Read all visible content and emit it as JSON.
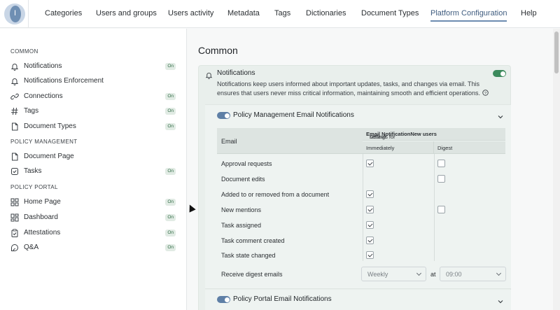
{
  "nav": {
    "logo_letter": "I",
    "items": [
      "Categories",
      "Users and groups",
      "Users activity",
      "Metadata",
      "Tags",
      "Dictionaries",
      "Document Types",
      "Platform Configuration",
      "Help"
    ],
    "active": "Platform Configuration"
  },
  "sidebar": {
    "sections": [
      {
        "title": "COMMON",
        "items": [
          {
            "label": "Notifications",
            "icon": "bell-icon",
            "badge": "On"
          },
          {
            "label": "Notifications Enforcement",
            "icon": "bell-icon",
            "badge": ""
          },
          {
            "label": "Connections",
            "icon": "link-icon",
            "badge": "On"
          },
          {
            "label": "Tags",
            "icon": "hash-icon",
            "badge": "On"
          },
          {
            "label": "Document Types",
            "icon": "document-icon",
            "badge": "On"
          }
        ]
      },
      {
        "title": "POLICY MANAGEMENT",
        "items": [
          {
            "label": "Document Page",
            "icon": "document-icon",
            "badge": ""
          },
          {
            "label": "Tasks",
            "icon": "check-square-icon",
            "badge": "On"
          }
        ]
      },
      {
        "title": "POLICY PORTAL",
        "items": [
          {
            "label": "Home Page",
            "icon": "grid-icon",
            "badge": "On"
          },
          {
            "label": "Dashboard",
            "icon": "dashboard-icon",
            "badge": "On"
          },
          {
            "label": "Attestations",
            "icon": "clipboard-check-icon",
            "badge": "On"
          },
          {
            "label": "Q&A",
            "icon": "chat-icon",
            "badge": "On"
          }
        ]
      }
    ]
  },
  "main": {
    "page_title": "Common",
    "notifications": {
      "title": "Notifications",
      "enabled": true,
      "description": "Notifications keep users informed about important updates, tasks, and changes via email. This ensures that users never miss critical information, maintaining smooth and efficient operations."
    },
    "policy_mgmt": {
      "title": "Policy Management Email Notifications",
      "enabled": true,
      "table": {
        "email_header": "Email",
        "group_header_prefix": "Default ",
        "group_header_bold1": "Email Notification",
        "group_header_mid": " settings for ",
        "group_header_bold2": "New users",
        "col_immediately": "Immediately",
        "col_digest": "Digest",
        "rows": [
          {
            "label": "Approval requests",
            "immediately": true,
            "digest": false,
            "has_digest": true
          },
          {
            "label": "Document edits",
            "immediately": null,
            "digest": false,
            "has_digest": true
          },
          {
            "label": "Added to or removed from a document",
            "immediately": true,
            "digest": null,
            "has_digest": false
          },
          {
            "label": "New mentions",
            "immediately": true,
            "digest": false,
            "has_digest": true
          },
          {
            "label": "Task assigned",
            "immediately": true,
            "digest": null,
            "has_digest": false
          },
          {
            "label": "Task comment created",
            "immediately": true,
            "digest": null,
            "has_digest": false
          },
          {
            "label": "Task state changed",
            "immediately": true,
            "digest": null,
            "has_digest": false
          }
        ]
      },
      "digest_label": "Receive digest emails",
      "frequency": "Weekly",
      "at_label": "at",
      "time": "09:00"
    },
    "policy_portal": {
      "title": "Policy Portal Email Notifications",
      "enabled": true
    }
  },
  "colors": {
    "accent": "#5e7fa6",
    "toggle_green": "#3c8a5c",
    "badge_bg": "#e1ebe4"
  }
}
